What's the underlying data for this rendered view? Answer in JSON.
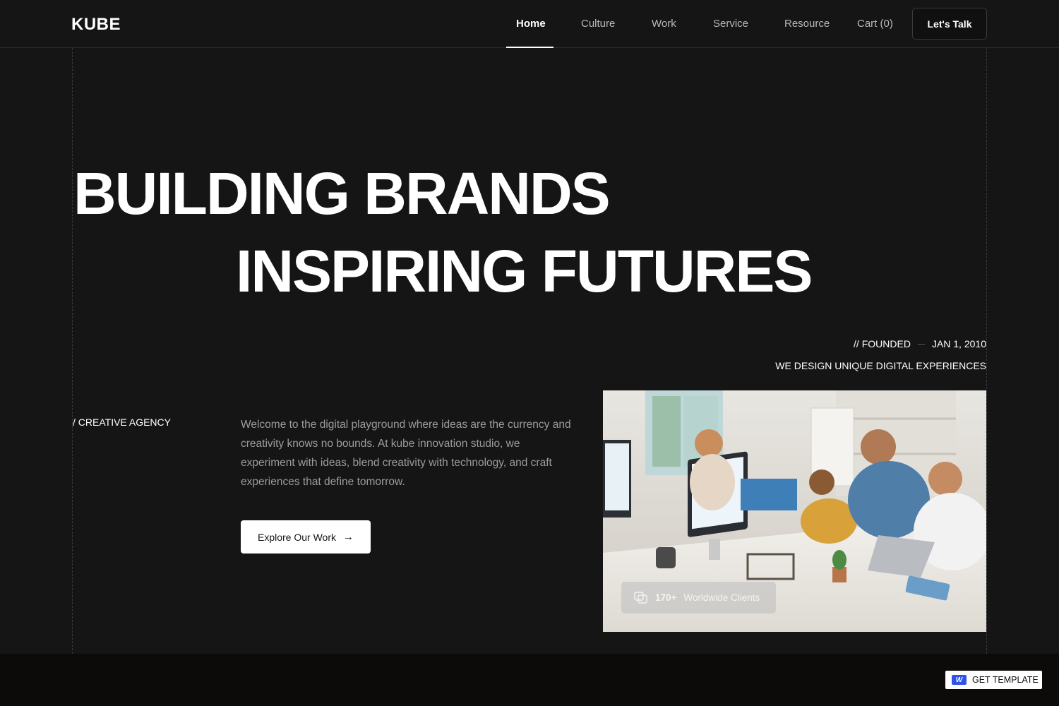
{
  "brand": {
    "logo": "KUBE"
  },
  "nav": {
    "items": [
      {
        "label": "Home",
        "active": true
      },
      {
        "label": "Culture",
        "active": false
      },
      {
        "label": "Work",
        "active": false
      },
      {
        "label": "Service",
        "active": false
      },
      {
        "label": "Resource",
        "active": false
      }
    ],
    "cart_label": "Cart",
    "cart_count": "(0)",
    "cta_label": "Let's Talk"
  },
  "hero": {
    "line1": "BUILDING BRANDS",
    "line2": "INSPIRING FUTURES",
    "founded_label": "// FOUNDED",
    "founded_date": "JAN 1, 2010",
    "tagline": "WE DESIGN UNIQUE DIGITAL EXPERIENCES",
    "agency_label": "/ CREATIVE AGENCY",
    "intro": "Welcome to the digital playground where ideas are the currency and creativity knows no bounds. At kube innovation studio, we experiment with ideas, blend creativity with technology, and craft experiences that define tomorrow.",
    "explore_label": "Explore Our Work",
    "clients_count": "170+",
    "clients_label": "Worldwide Clients"
  },
  "badge": {
    "get_template_label": "GET TEMPLATE",
    "logo_letter": "W"
  },
  "colors": {
    "background": "#151516",
    "text": "#ffffff",
    "muted": "#9c9c9f",
    "footer": "#0c0b0a",
    "webflow_blue": "#2f55e8"
  }
}
